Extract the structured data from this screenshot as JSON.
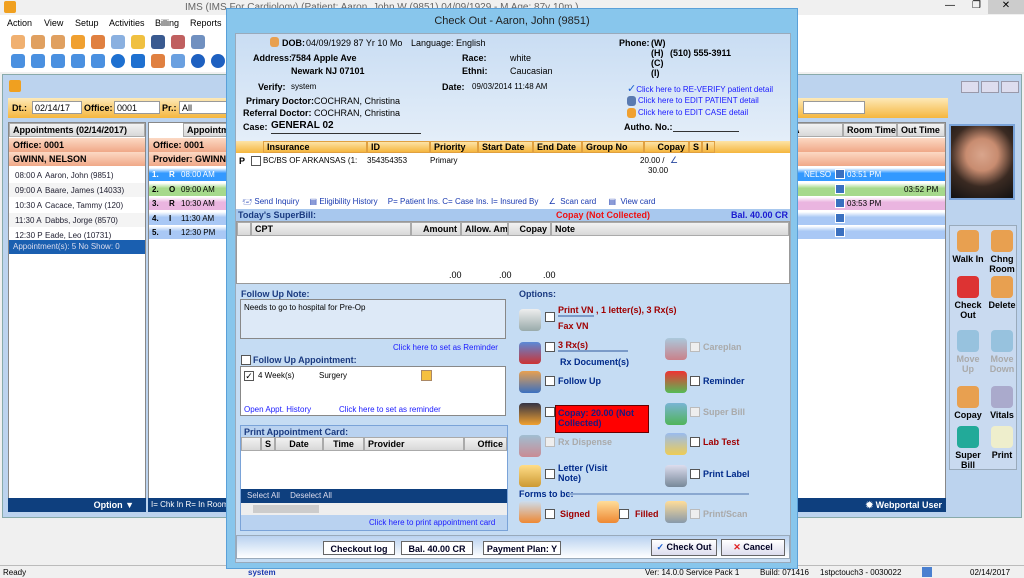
{
  "app": {
    "title": "IMS (IMS  For Cardiology)     (Patient: Aaron, John W (9851) 04/09/1929 - M Age: 87y 10m )"
  },
  "menu": [
    "Action",
    "View",
    "Setup",
    "Activities",
    "Billing",
    "Reports"
  ],
  "filter": {
    "dt_label": "Dt.:",
    "dt_value": "02/14/17",
    "office_label": "Office:",
    "office_value": "0001",
    "pr_label": "Pr.:",
    "pr_value": "All"
  },
  "left": {
    "title": "Appointments (02/14/2017)",
    "office": "Office: 0001",
    "provider": "GWINN, NELSON",
    "items": [
      {
        "time": "08:00 A",
        "name": "Aaron, John  (9851)"
      },
      {
        "time": "09:00 A",
        "name": "Baare, James  (14033)"
      },
      {
        "time": "10:30 A",
        "name": "Cacace, Tammy  (120)"
      },
      {
        "time": "11:30 A",
        "name": "Dabbs, Jorge  (8570)"
      },
      {
        "time": "12:30 P",
        "name": "Eade, Leo  (10731)"
      }
    ],
    "summary": "Appointment(s): 5   No Show: 0",
    "option": "Option ▼"
  },
  "grid": {
    "col_appt": "Appointm",
    "col_a": "A",
    "col_room": "Room Time",
    "col_out": "Out Time",
    "office": "Office: 0001",
    "provider": "Provider: GWINN",
    "rows": [
      {
        "n": "1.",
        "s": "R",
        "t": "08:00 AM",
        "p": "NELSO",
        "room": "03:51 PM",
        "out": "",
        "color": "#3399ff"
      },
      {
        "n": "2.",
        "s": "O",
        "t": "09:00 AM",
        "p": "",
        "room": "",
        "out": "03:52 PM",
        "color": "#a6d98c"
      },
      {
        "n": "3.",
        "s": "R",
        "t": "10:30 AM",
        "p": "",
        "room": "03:53 PM",
        "out": "",
        "color": "#eab5e0"
      },
      {
        "n": "4.",
        "s": "I",
        "t": "11:30 AM",
        "p": "",
        "room": "",
        "out": "",
        "color": "#a9c8f5"
      },
      {
        "n": "5.",
        "s": "I",
        "t": "12:30 PM",
        "p": "",
        "room": "",
        "out": "",
        "color": "#a9c8f5"
      }
    ],
    "legend": "I= Chk In  R= In Room",
    "webportal": "Webportal User"
  },
  "right_buttons": [
    {
      "label": "Walk In",
      "enabled": true
    },
    {
      "label": "Chng Room",
      "enabled": true
    },
    {
      "label": "Check Out",
      "enabled": true
    },
    {
      "label": "Delete",
      "enabled": true
    },
    {
      "label": "Move Up",
      "enabled": false
    },
    {
      "label": "Move Down",
      "enabled": false
    },
    {
      "label": "Copay",
      "enabled": true
    },
    {
      "label": "Vitals",
      "enabled": true
    },
    {
      "label": "Super Bill",
      "enabled": true
    },
    {
      "label": "Print",
      "enabled": true
    }
  ],
  "dialog": {
    "title": "Check Out - Aaron, John  (9851)",
    "patient": {
      "dob_label": "DOB:",
      "dob": "04/09/1929 87 Yr 10 Mo",
      "language": "Language: English",
      "address_label": "Address:",
      "address1": "7584 Apple Ave",
      "address2": "Newark  NJ  07101",
      "race_label": "Race:",
      "race": "white",
      "ethni_label": "Ethni:",
      "ethni": "Caucasian",
      "phone_label": "Phone:",
      "phone_w": "(W)",
      "phone_h": "(H)",
      "phone_h_val": "(510) 555-3911",
      "phone_c": "(C)",
      "phone_i": "(I)",
      "verify_label": "Verify:",
      "verify": "system",
      "date_label": "Date:",
      "date": "09/03/2014 11:48 AM",
      "primary_label": "Primary Doctor:",
      "primary": "COCHRAN, Christina",
      "referral_label": "Referral Doctor:",
      "referral": "COCHRAN, Christina",
      "case_label": "Case:",
      "case": "GENERAL 02",
      "autho_label": "Autho. No.:",
      "reverify": "Click here to RE-VERIFY patient detail",
      "edit_patient": "Click here to EDIT PATIENT detail",
      "edit_case": "Click here to EDIT CASE detail"
    },
    "insurance": {
      "headers": [
        "Insurance",
        "ID",
        "Priority",
        "Start Date",
        "End Date",
        "Group No",
        "Copay",
        "S",
        "I"
      ],
      "rows": [
        {
          "type": "P",
          "insurance": "BC/BS OF ARKANSAS   (1:",
          "id": "354354353",
          "priority": "Primary",
          "copay1": "20.00 /",
          "copay2": "30.00"
        }
      ],
      "links": {
        "send": "Send Inquiry",
        "elig": "Eligibility History",
        "legend": "P= Patient Ins. C= Case Ins.  I= Insured By",
        "scan": "Scan card",
        "view": "View card"
      }
    },
    "superbill": {
      "title": "Today's SuperBill:",
      "copay_status": "Copay (Not Collected)",
      "balance": "Bal. 40.00 CR",
      "headers": [
        "CPT",
        "Amount",
        "Allow. Amt",
        "Copay",
        "Note"
      ],
      "totals": [
        ".00",
        ".00",
        ".00"
      ]
    },
    "followup": {
      "note_label": "Follow Up Note:",
      "note": "Needs to go to hospital for Pre-Op",
      "reminder_link": "Click here to set as Reminder",
      "appt_label": "Follow Up Appointment:",
      "appt_checked": false,
      "item_checked": true,
      "item_period": "4  Week(s)",
      "item_type": "Surgery",
      "history": "Open Appt. History",
      "reminder2": "Click here to set as reminder"
    },
    "print_card": {
      "title": "Print Appointment Card:",
      "headers": [
        "S",
        "Date",
        "Time",
        "Provider",
        "Office"
      ],
      "select_all": "Select All",
      "deselect_all": "Deselect All",
      "print_link": "Click here to print appointment card"
    },
    "options": {
      "title": "Options:",
      "print_vn": "Print VN",
      "print_vn_extra": ", 1 letter(s), 3 Rx(s)",
      "fax_vn": "Fax VN",
      "rx": "3 Rx(s)",
      "rx_doc": "Rx Document(s)",
      "careplan": "Careplan",
      "follow_up": "Follow Up",
      "reminder": "Reminder",
      "copay": "Copay: 20.00 (Not Collected)",
      "super_bill": "Super Bill",
      "rx_dispense": "Rx Dispense",
      "lab_test": "Lab Test",
      "letter": "Letter (Visit Note)",
      "print_label": "Print Label",
      "forms": "Forms to be:",
      "signed": "Signed",
      "filled": "Filled",
      "print_scan": "Print/Scan"
    },
    "footer": {
      "log": "Checkout log",
      "bal": "Bal. 40.00 CR",
      "plan": "Payment Plan: Y",
      "checkout": "Check Out",
      "cancel": "Cancel"
    }
  },
  "status": {
    "ready": "Ready",
    "user": "system",
    "version": "Ver: 14.0.0 Service Pack 1",
    "build": "Build: 071416",
    "station": "1stpctouch3 - 0030022",
    "date": "02/14/2017"
  },
  "colors": {
    "accent": "#f5b63e",
    "dialog": "#c5dcf3",
    "copay_alert": "#ff0000",
    "selected": "#3399ff"
  }
}
